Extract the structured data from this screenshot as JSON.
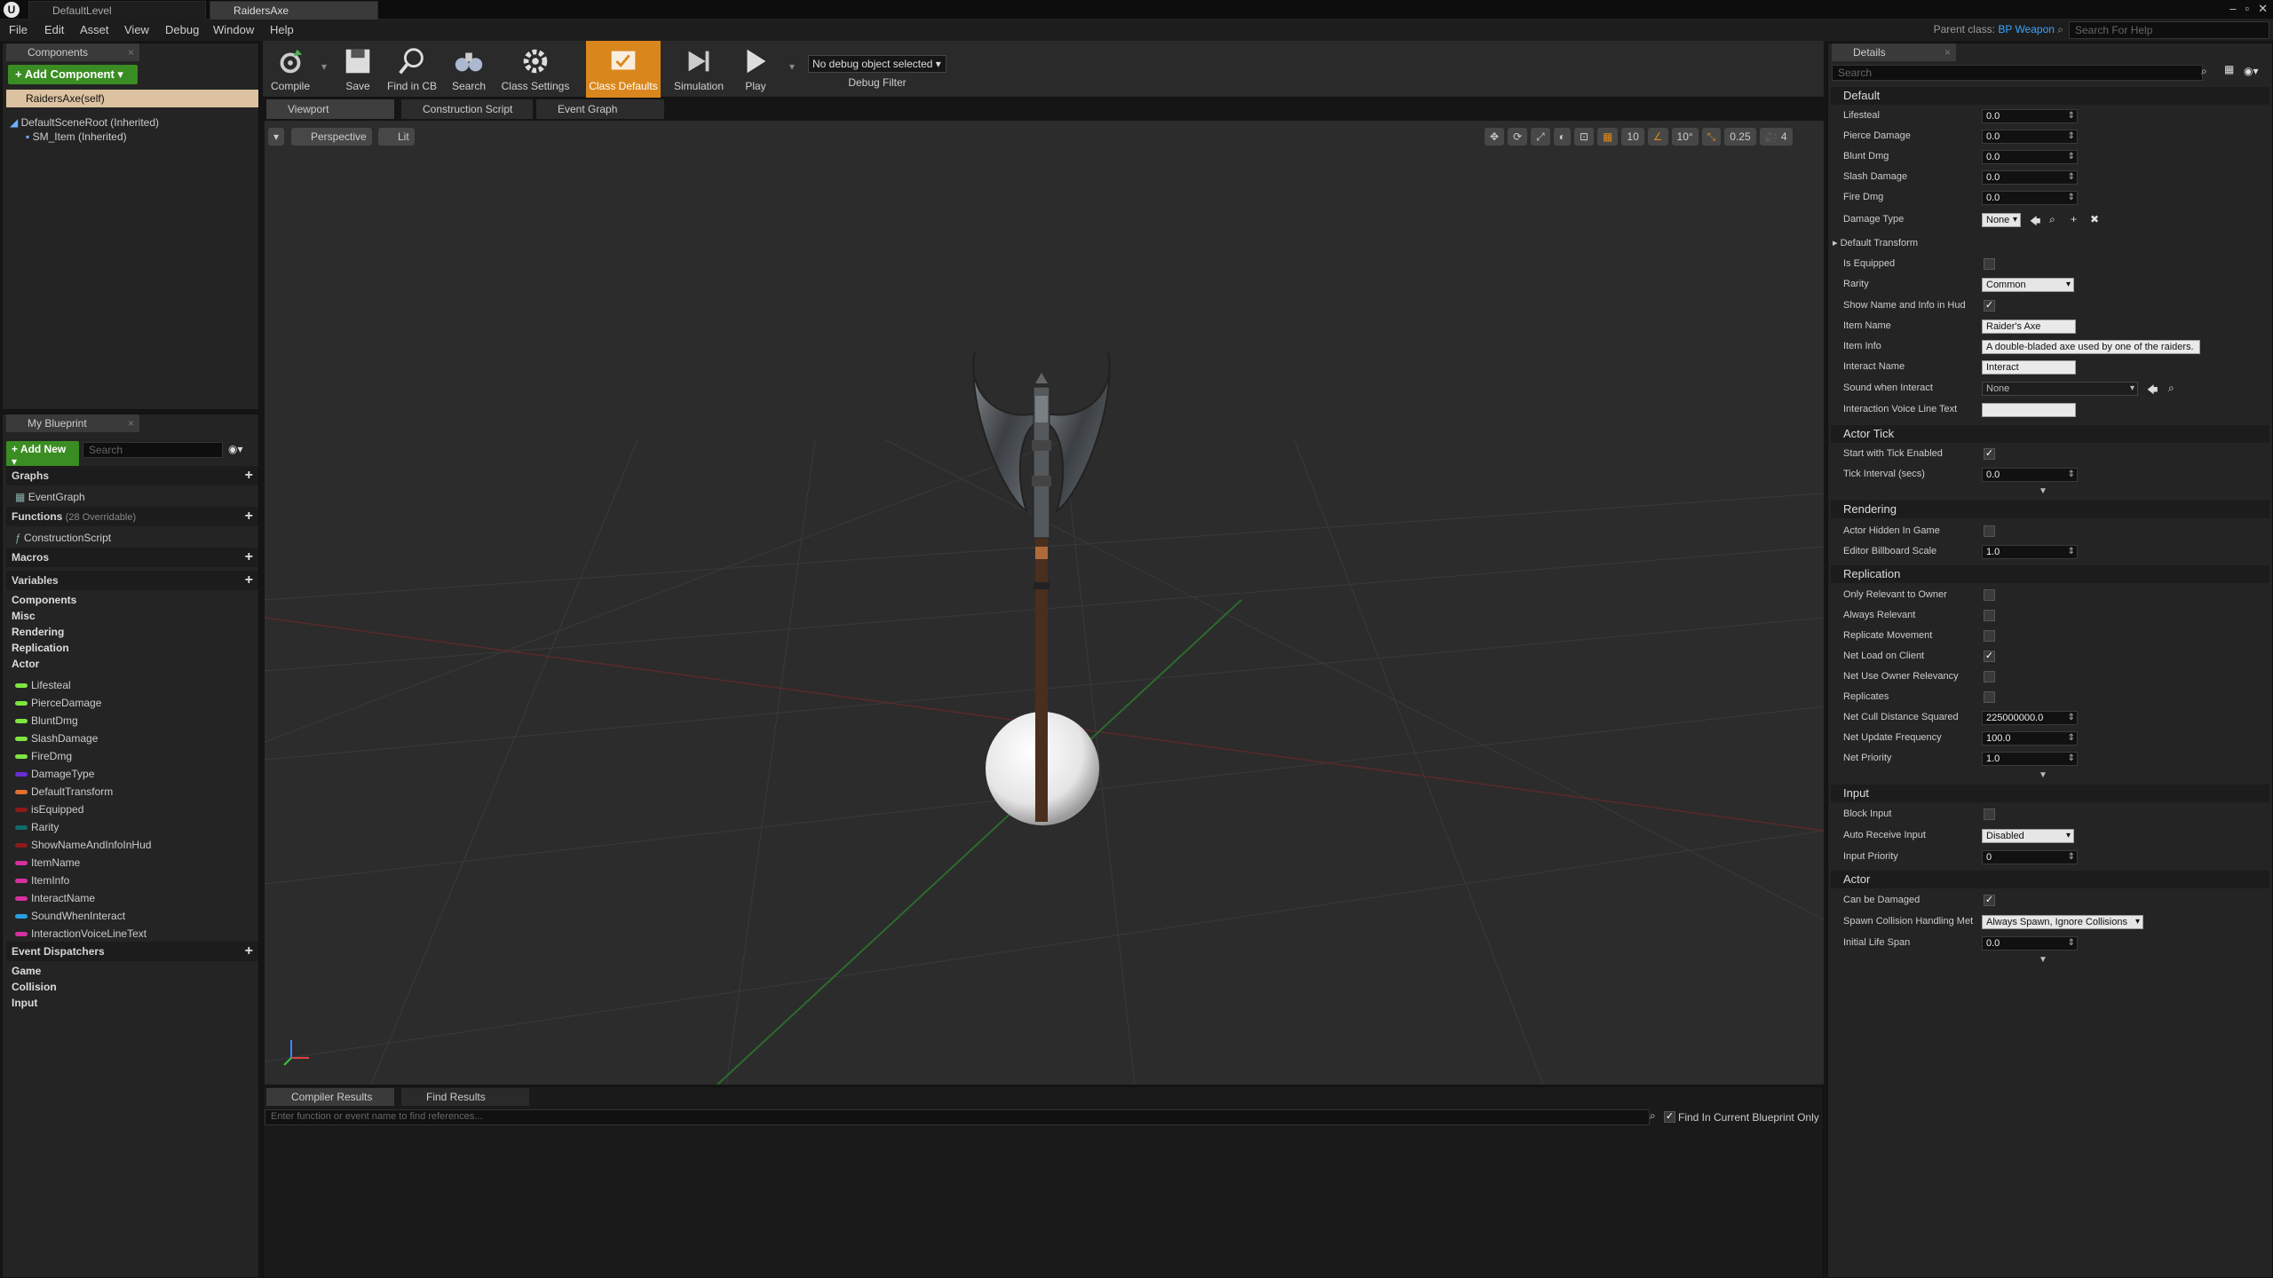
{
  "titlebar": {
    "tabs": [
      "DefaultLevel",
      "RaidersAxe"
    ],
    "window_buttons": [
      "minimize-icon",
      "restore-icon",
      "close-icon"
    ]
  },
  "menu": {
    "items": [
      "File",
      "Edit",
      "Asset",
      "View",
      "Debug",
      "Window",
      "Help"
    ],
    "parent_class_label": "Parent class:",
    "parent_class_value": "BP Weapon",
    "help_search_placeholder": "Search For Help"
  },
  "components": {
    "tab": "Components",
    "add_button": "+ Add Component ▾",
    "self_item": "RaidersAxe(self)",
    "tree": [
      "DefaultSceneRoot (Inherited)",
      "SM_Item (Inherited)"
    ]
  },
  "my_blueprint": {
    "tab": "My Blueprint",
    "add_new": "+ Add New ▾",
    "search_placeholder": "Search",
    "graphs_label": "Graphs",
    "graph_items": [
      "EventGraph"
    ],
    "functions_label": "Functions",
    "functions_count": "(28 Overridable)",
    "function_items": [
      "ConstructionScript"
    ],
    "macros_label": "Macros",
    "variables_label": "Variables",
    "var_categories": [
      "Components",
      "Misc",
      "Rendering",
      "Replication",
      "Actor"
    ],
    "variables": [
      {
        "name": "Lifesteal",
        "color": "#7ee540"
      },
      {
        "name": "PierceDamage",
        "color": "#7ee540"
      },
      {
        "name": "BluntDmg",
        "color": "#7ee540"
      },
      {
        "name": "SlashDamage",
        "color": "#7ee540"
      },
      {
        "name": "FireDmg",
        "color": "#7ee540"
      },
      {
        "name": "DamageType",
        "color": "#6a2dd6"
      },
      {
        "name": "DefaultTransform",
        "color": "#e07030"
      },
      {
        "name": "isEquipped",
        "color": "#8b1a1a"
      },
      {
        "name": "Rarity",
        "color": "#0f6b6b"
      },
      {
        "name": "ShowNameAndInfoInHud",
        "color": "#8b1a1a"
      },
      {
        "name": "ItemName",
        "color": "#d6309e"
      },
      {
        "name": "ItemInfo",
        "color": "#d6309e"
      },
      {
        "name": "InteractName",
        "color": "#d6309e"
      },
      {
        "name": "SoundWhenInteract",
        "color": "#2a9ee0"
      },
      {
        "name": "InteractionVoiceLineText",
        "color": "#d6309e"
      }
    ],
    "event_dispatchers_label": "Event Dispatchers",
    "dispatcher_categories": [
      "Game",
      "Collision",
      "Input"
    ]
  },
  "toolbar": {
    "compile": "Compile",
    "save": "Save",
    "find_in_cb": "Find in CB",
    "search": "Search",
    "class_settings": "Class Settings",
    "class_defaults": "Class Defaults",
    "simulation": "Simulation",
    "play": "Play",
    "debug_select": "No debug object selected",
    "debug_filter": "Debug Filter"
  },
  "editor_tabs": [
    "Viewport",
    "Construction Script",
    "Event Graph"
  ],
  "viewport": {
    "perspective": "Perspective",
    "lit": "Lit",
    "grid_snap": "10",
    "rot_snap": "10°",
    "scale_snap": "0.25",
    "camera_speed": "4"
  },
  "bottom": {
    "tabs": [
      "Compiler Results",
      "Find Results"
    ],
    "find_placeholder": "Enter function or event name to find references...",
    "find_current_only": "Find In Current Blueprint Only"
  },
  "details": {
    "tab": "Details",
    "search_placeholder": "Search",
    "sections": {
      "default": "Default",
      "actor_tick": "Actor Tick",
      "rendering": "Rendering",
      "replication": "Replication",
      "input": "Input",
      "actor": "Actor"
    },
    "default_props": {
      "lifesteal_label": "Lifesteal",
      "lifesteal": "0.0",
      "pierce_label": "Pierce Damage",
      "pierce": "0.0",
      "blunt_label": "Blunt Dmg",
      "blunt": "0.0",
      "slash_label": "Slash Damage",
      "slash": "0.0",
      "fire_label": "Fire Dmg",
      "fire": "0.0",
      "damage_type_label": "Damage Type",
      "damage_type": "None",
      "default_transform_label": "Default Transform",
      "is_equipped_label": "Is Equipped",
      "is_equipped": false,
      "rarity_label": "Rarity",
      "rarity": "Common",
      "show_name_label": "Show Name and Info in Hud",
      "show_name": true,
      "item_name_label": "Item Name",
      "item_name": "Raider's Axe",
      "item_info_label": "Item Info",
      "item_info": "A double-bladed axe used by one of the raiders.",
      "interact_name_label": "Interact Name",
      "interact_name": "Interact",
      "sound_label": "Sound when Interact",
      "sound": "None",
      "voice_line_label": "Interaction Voice Line Text",
      "voice_line": ""
    },
    "actor_tick_props": {
      "start_tick_label": "Start with Tick Enabled",
      "start_tick": true,
      "tick_interval_label": "Tick Interval (secs)",
      "tick_interval": "0.0"
    },
    "rendering_props": {
      "hidden_label": "Actor Hidden In Game",
      "hidden": false,
      "billboard_label": "Editor Billboard Scale",
      "billboard": "1.0"
    },
    "replication_props": {
      "only_owner_label": "Only Relevant to Owner",
      "only_owner": false,
      "always_relevant_label": "Always Relevant",
      "always_relevant": false,
      "replicate_movement_label": "Replicate Movement",
      "replicate_movement": false,
      "net_load_label": "Net Load on Client",
      "net_load": true,
      "net_owner_label": "Net Use Owner Relevancy",
      "net_owner": false,
      "replicates_label": "Replicates",
      "replicates": false,
      "cull_label": "Net Cull Distance Squared",
      "cull": "225000000.0",
      "update_freq_label": "Net Update Frequency",
      "update_freq": "100.0",
      "priority_label": "Net Priority",
      "priority": "1.0"
    },
    "input_props": {
      "block_label": "Block Input",
      "block": false,
      "auto_receive_label": "Auto Receive Input",
      "auto_receive": "Disabled",
      "input_priority_label": "Input Priority",
      "input_priority": "0"
    },
    "actor_props": {
      "can_damage_label": "Can be Damaged",
      "can_damage": true,
      "spawn_label": "Spawn Collision Handling Met",
      "spawn": "Always Spawn, Ignore Collisions",
      "lifespan_label": "Initial Life Span",
      "lifespan": "0.0"
    }
  },
  "colors": {
    "accent_orange": "#d9871c",
    "add_green": "#3a8d22",
    "link_blue": "#3aa5ff"
  }
}
